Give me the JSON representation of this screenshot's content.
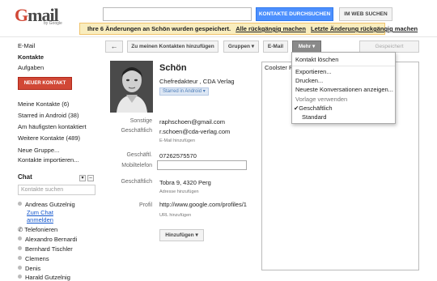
{
  "header": {
    "logo_text": "Gmail",
    "logo_sub": "by Google",
    "search_button": "KONTAKTE DURCHSUCHEN",
    "web_button": "IM WEB SUCHEN"
  },
  "notice": {
    "message": "Ihre 6 Änderungen an Schön wurden gespeichert.",
    "undo_all": "Alle rückgängig machen",
    "undo_last": "Letzte Änderung rückgängig machen"
  },
  "sidebar": {
    "mail": "E-Mail",
    "contacts": "Kontakte",
    "tasks": "Aufgaben",
    "new_contact": "NEUER KONTAKT",
    "groups": [
      "Meine Kontakte (6)",
      "Starred in Android (38)",
      "Am häufigsten kontaktiert",
      "Weitere Kontakte (489)"
    ],
    "new_group": "Neue Gruppe...",
    "import": "Kontakte importieren..."
  },
  "chat": {
    "title": "Chat",
    "search_placeholder": "Kontakte suchen",
    "self_name": "Andreas Gutzelnig",
    "self_status": "Zum Chat",
    "self_signin": "anmelden",
    "phone": "Telefonieren",
    "contacts": [
      "Alexandro Bernardi",
      "Bernhard Tischler",
      "Clemens",
      "Denis",
      "Harald Gutzelnig"
    ]
  },
  "toolbar": {
    "back": "←",
    "add_to_my_contacts": "Zu meinen Kontakten hinzufügen",
    "groups": "Gruppen ▾",
    "email": "E-Mail",
    "more": "Mehr ▾",
    "saved": "Gespeichert"
  },
  "contact": {
    "name": "Schön",
    "title": "Chefredakteur ,  CDA Verlag",
    "group_badge": "Starred in Android ▾",
    "email_label_1": "Sonstige",
    "email_1": "raphschoen@gmail.com",
    "email_label_2": "Geschäftlich",
    "email_2": "r.schoen@cda-verlag.com",
    "email_hint": "E-Mail hinzufügen",
    "phone_label_1": "Geschäftl.",
    "phone_1": "07262575570",
    "phone_label_2": "Mobiltelefon",
    "phone_2": "",
    "address_label": "Geschäftlich",
    "address": "Tobra 9, 4320 Perg",
    "address_hint": "Adresse hinzufügen",
    "profile_label": "Profil",
    "profile_url": "http://www.google.com/profiles/11",
    "url_hint": "URL hinzufügen",
    "add_button": "Hinzufügen ▾",
    "notes": "Coolster Ra"
  },
  "menu": {
    "delete": "Kontakt löschen",
    "export": "Exportieren...",
    "print": "Drucken...",
    "recent": "Neueste Konversationen anzeigen...",
    "template_header": "Vorlage verwenden",
    "business": "✔Geschäftlich",
    "standard": "Standard"
  },
  "colors": {
    "primary_blue": "#4d90fe",
    "new_red": "#d14836",
    "notice_bg": "#f9edbe"
  }
}
